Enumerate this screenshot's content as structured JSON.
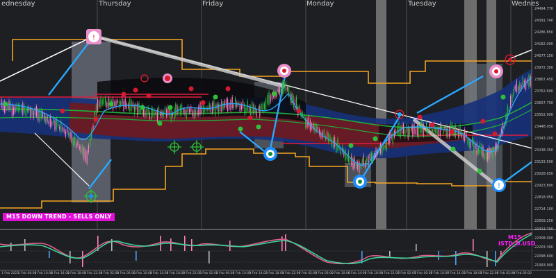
{
  "days": [
    {
      "id": "wed1",
      "label": "ednesday"
    },
    {
      "id": "thu",
      "label": "Thursday"
    },
    {
      "id": "fri",
      "label": "Friday"
    },
    {
      "id": "mon",
      "label": "Monday"
    },
    {
      "id": "tue",
      "label": "Tuesday"
    },
    {
      "id": "wed2",
      "label": "Wednes"
    }
  ],
  "price_ticks": [
    "24494.770",
    "24391.740",
    "24286.850",
    "24182.000",
    "24077.150",
    "23972.300",
    "23867.450",
    "23762.600",
    "23657.750",
    "23552.900",
    "23448.050",
    "23343.200",
    "23238.350",
    "23133.500",
    "23028.650",
    "22923.800",
    "22818.950",
    "22714.100",
    "22609.250"
  ],
  "indicator_ticks": [
    "22412.700",
    "22308.000",
    "22203.300",
    "22098.600",
    "21993.900"
  ],
  "time_ticks": [
    "1 Feb 2023",
    "1 Feb 06:00",
    "1 Feb 10:00",
    "1 Feb 14:00",
    "1 Feb 18:00",
    "1 Feb 22:00",
    "2 Feb 02:00",
    "2 Feb 06:00",
    "2 Feb 10:00",
    "2 Feb 14:00",
    "2 Feb 18:00",
    "2 Feb 22:00",
    "3 Feb 02:00",
    "3 Feb 06:00",
    "3 Feb 10:00",
    "3 Feb 14:00",
    "3 Feb 18:00",
    "3 Feb 22:00",
    "6 Feb 02:00",
    "6 Feb 06:00",
    "6 Feb 10:00",
    "6 Feb 14:00",
    "6 Feb 18:00",
    "6 Feb 22:00",
    "7 Feb 02:00",
    "7 Feb 06:00",
    "7 Feb 10:00",
    "7 Feb 14:00",
    "7 Feb 18:00",
    "7 Feb 22:00",
    "8 Feb 02:00",
    "8 Feb 06:00"
  ],
  "trend_badge": "M15  DOWN TREND - SELLS ONLY",
  "sub_label_1": "M15",
  "sub_label_2": "ISTD_D.USD",
  "colors": {
    "background": "#1e1f22",
    "orange_channel": "#f5a623",
    "blue_band": "#16307a",
    "red_band": "#6a1a22",
    "candle_up": "#2fc03a",
    "candle_down": "#ff7fc0",
    "trend_line": "#ffffff",
    "blue_line": "#2aa8ff",
    "badge": "#e010d8"
  }
}
